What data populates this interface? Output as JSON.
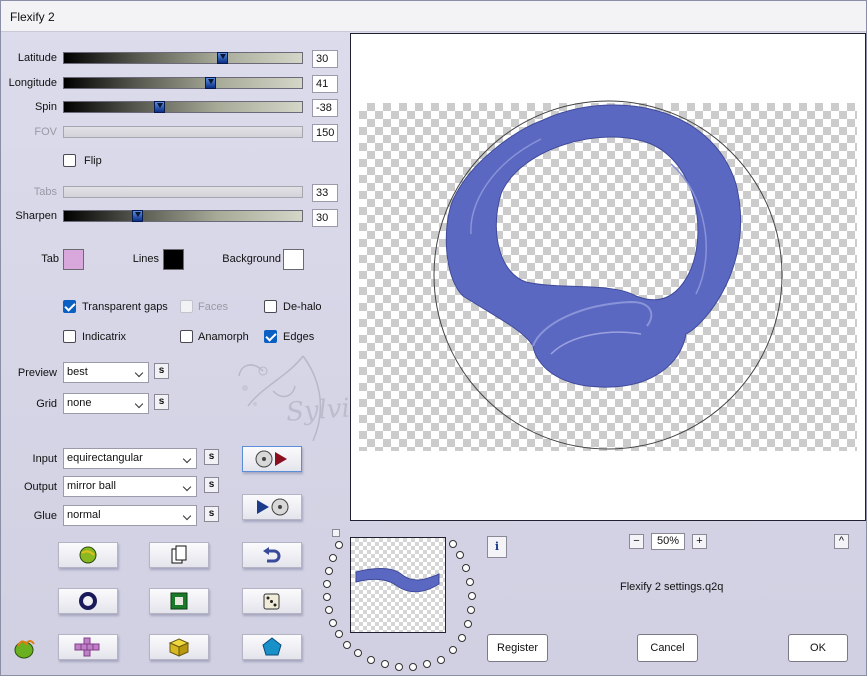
{
  "window": {
    "title": "Flexify 2"
  },
  "sliders": [
    {
      "label": "Latitude",
      "value": "30",
      "level": 0.66,
      "enabled": true
    },
    {
      "label": "Longitude",
      "value": "41",
      "level": 0.61,
      "enabled": true
    },
    {
      "label": "Spin",
      "value": "-38",
      "level": 0.4,
      "enabled": true
    },
    {
      "label": "FOV",
      "value": "150",
      "enabled": false
    },
    {
      "label": "Tabs",
      "value": "33",
      "enabled": false
    },
    {
      "label": "Sharpen",
      "value": "30",
      "level": 0.31,
      "enabled": true
    }
  ],
  "flip": {
    "label": "Flip",
    "checked": false
  },
  "colors": {
    "tab": {
      "label": "Tab",
      "color": "#d8a8dc"
    },
    "lines": {
      "label": "Lines",
      "color": "#000000"
    },
    "background": {
      "label": "Background",
      "color": "#ffffff"
    }
  },
  "options": {
    "transparent_gaps": {
      "label": "Transparent gaps",
      "checked": true
    },
    "faces": {
      "label": "Faces",
      "checked": false,
      "enabled": false
    },
    "de_halo": {
      "label": "De-halo",
      "checked": false
    },
    "indicatrix": {
      "label": "Indicatrix",
      "checked": false
    },
    "anamorph": {
      "label": "Anamorph",
      "checked": false
    },
    "edges": {
      "label": "Edges",
      "checked": true
    }
  },
  "preview_select": {
    "label": "Preview",
    "value": "best"
  },
  "grid_select": {
    "label": "Grid",
    "value": "none"
  },
  "input_select": {
    "label": "Input",
    "value": "equirectangular"
  },
  "output_select": {
    "label": "Output",
    "value": "mirror ball"
  },
  "glue_select": {
    "label": "Glue",
    "value": "normal"
  },
  "s_button": "s",
  "zoom": {
    "minus": "−",
    "value": "50%",
    "plus": "+"
  },
  "info_button": "i",
  "collapse_button": "^",
  "settings_file": "Flexify 2 settings.q2q",
  "buttons": {
    "register": "Register",
    "cancel": "Cancel",
    "ok": "OK"
  },
  "watermark": "Sylviane",
  "accent_color": "#5b68c2"
}
